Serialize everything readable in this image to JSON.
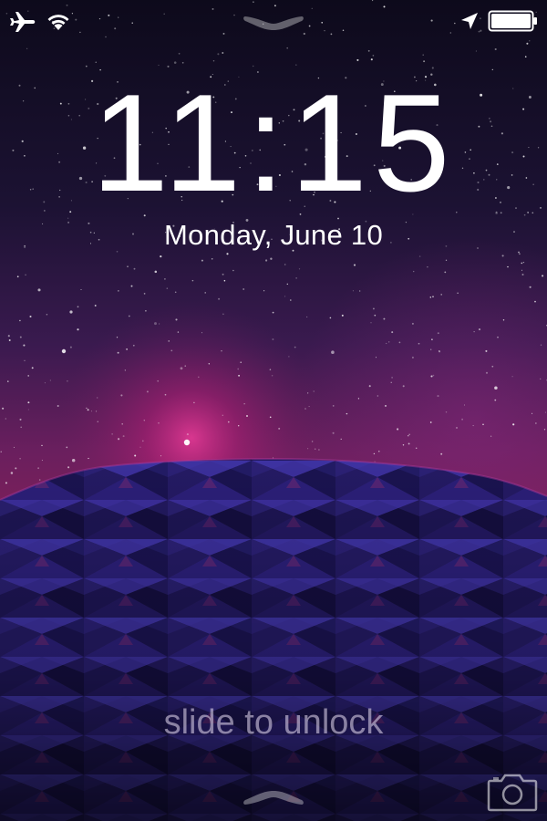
{
  "lock_screen": {
    "time": "11:15",
    "date": "Monday, June 10",
    "slide_prompt": "slide to unlock"
  },
  "status_bar": {
    "left_icons": [
      "airplane-icon",
      "wifi-icon"
    ],
    "right_icons": [
      "location-arrow-icon",
      "battery-icon"
    ],
    "battery_level": 1.0
  },
  "icons": {
    "camera": "camera-icon",
    "top_grabber": "chevron-grabber-icon",
    "bottom_grabber": "chevron-grabber-icon"
  },
  "colors": {
    "text": "#ffffff",
    "slide_text": "#c8bfd6",
    "sky_top": "#0e0a1c",
    "sky_glow": "#c2207a",
    "geodesic_dark": "#120b2e",
    "geodesic_mid": "#3b2a8c",
    "geodesic_highlight": "#5a3fd0"
  }
}
